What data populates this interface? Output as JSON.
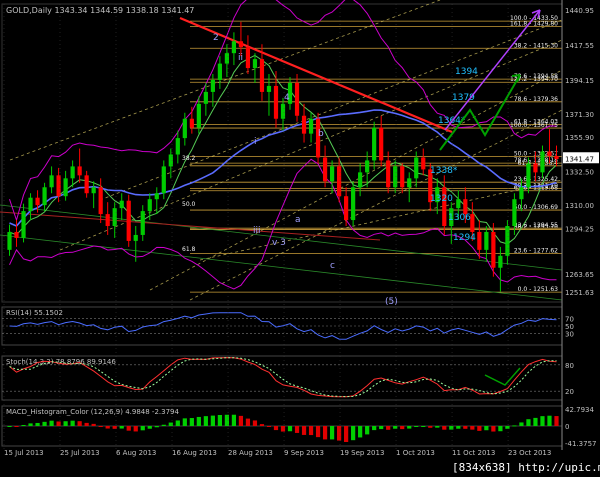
{
  "colors": {
    "background": "#000000",
    "bull": "#00cc00",
    "bear": "#ff0000",
    "axis_text": "#c0c0c0",
    "grid": "#404040",
    "ma": "#5a6cff",
    "ma_fast": "#55cc55",
    "bb": "#cc00cc",
    "fib": "#e0b040",
    "fib_text": "#f0f0f0",
    "trend_red": "#ff2020",
    "trend_green": "#00aa00",
    "trend_dotted": "#d0c060",
    "wave_label": "#a0a0ff",
    "target_label": "#20c0ff",
    "rsi": "#4a6cff",
    "stoch_main": "#ff3030",
    "stoch_signal": "#a0ffa0",
    "macd_pos": "#00d000",
    "macd_neg": "#e00000",
    "current_price_bg": "#ffffff",
    "arrow_green": "#00a000",
    "arrow_purple": "#b040ff"
  },
  "main_panel": {
    "header": "GOLD,Daily  1343.34 1344.59 1338.18 1341.47",
    "current_price": "1341.47",
    "price_axis_labels": [
      "1440.95",
      "1417.55",
      "1394.15",
      "1371.30",
      "1355.90",
      "1332.50",
      "1310.00",
      "1294.25",
      "1263.65",
      "1251.63"
    ],
    "ylim": [
      1245,
      1445
    ]
  },
  "date_labels": [
    "15 Jul 2013",
    "25 Jul 2013",
    "6 Aug 2013",
    "16 Aug 2013",
    "28 Aug 2013",
    "9 Sep 2013",
    "19 Sep 2013",
    "1 Oct 2013",
    "11 Oct 2013",
    "23 Oct 2013"
  ],
  "fib_labels_right": [
    {
      "text": "100.0 - 1433.50",
      "price": 1433.5
    },
    {
      "text": "161.8 - 1429.80",
      "price": 1429.8
    },
    {
      "text": "38.2 - 1415.30",
      "price": 1415.3
    },
    {
      "text": "78.6 - 1394.58",
      "price": 1394.58
    },
    {
      "text": "127.2 - 1394.70",
      "price": 1392.5
    },
    {
      "text": "78.6 - 1379.36",
      "price": 1379.36
    },
    {
      "text": "61.8 - 1364.03",
      "price": 1364.03
    },
    {
      "text": "100.0 - 1361.75",
      "price": 1361.75
    },
    {
      "text": "50.0 - 1342.57",
      "price": 1342.57
    },
    {
      "text": "78.6 - 1338.18",
      "price": 1338.18
    },
    {
      "text": "61.8 - 1336.4",
      "price": 1336.4
    },
    {
      "text": "23.6 - 1325.42",
      "price": 1325.42
    },
    {
      "text": "38.2 - 1321.10",
      "price": 1321.1
    },
    {
      "text": "61.8 - 1319.68",
      "price": 1319.68
    },
    {
      "text": "50.0 - 1306.69",
      "price": 1306.69
    },
    {
      "text": "38.2 - 1293.70",
      "price": 1293.7
    },
    {
      "text": "23.6 - 1294.55",
      "price": 1294.55
    },
    {
      "text": "23.6 - 1277.62",
      "price": 1277.62
    },
    {
      "text": "0.0 - 1251.63",
      "price": 1251.63
    }
  ],
  "wave_labels": [
    "2",
    "ii",
    "4",
    "b",
    "i",
    "iii",
    "v 3",
    "a",
    "c",
    "(5)",
    "38.2",
    "50.0",
    "61.8"
  ],
  "target_labels": [
    "1394",
    "1379",
    "1364*",
    "1338*",
    "1320",
    "1306",
    "1294"
  ],
  "chart_data": {
    "type": "candlestick",
    "title": "GOLD,Daily",
    "ohlc_header": {
      "open": 1343.34,
      "high": 1344.59,
      "low": 1338.18,
      "close": 1341.47
    },
    "x_tick_labels": [
      "15 Jul 2013",
      "25 Jul 2013",
      "6 Aug 2013",
      "16 Aug 2013",
      "28 Aug 2013",
      "9 Sep 2013",
      "19 Sep 2013",
      "1 Oct 2013",
      "11 Oct 2013",
      "23 Oct 2013"
    ],
    "y_tick_labels": [
      1440.95,
      1417.55,
      1394.15,
      1371.3,
      1355.9,
      1332.5,
      1310.0,
      1294.25,
      1263.65,
      1251.63
    ],
    "ylim": [
      1245,
      1445
    ],
    "candles": [
      [
        1280,
        1297,
        1276,
        1292
      ],
      [
        1292,
        1300,
        1282,
        1288
      ],
      [
        1288,
        1311,
        1285,
        1306
      ],
      [
        1306,
        1318,
        1300,
        1315
      ],
      [
        1315,
        1320,
        1305,
        1310
      ],
      [
        1310,
        1325,
        1306,
        1322
      ],
      [
        1322,
        1336,
        1318,
        1330
      ],
      [
        1330,
        1335,
        1312,
        1316
      ],
      [
        1316,
        1333,
        1313,
        1328
      ],
      [
        1328,
        1340,
        1322,
        1336
      ],
      [
        1336,
        1348,
        1325,
        1330
      ],
      [
        1330,
        1333,
        1315,
        1318
      ],
      [
        1318,
        1326,
        1308,
        1322
      ],
      [
        1322,
        1328,
        1298,
        1304
      ],
      [
        1304,
        1312,
        1290,
        1296
      ],
      [
        1296,
        1312,
        1288,
        1308
      ],
      [
        1308,
        1318,
        1300,
        1313
      ],
      [
        1313,
        1317,
        1282,
        1286
      ],
      [
        1286,
        1296,
        1272,
        1290
      ],
      [
        1290,
        1310,
        1286,
        1306
      ],
      [
        1306,
        1318,
        1300,
        1314
      ],
      [
        1314,
        1322,
        1304,
        1318
      ],
      [
        1318,
        1340,
        1314,
        1336
      ],
      [
        1336,
        1348,
        1328,
        1344
      ],
      [
        1344,
        1360,
        1338,
        1355
      ],
      [
        1355,
        1372,
        1350,
        1368
      ],
      [
        1368,
        1376,
        1358,
        1362
      ],
      [
        1362,
        1383,
        1358,
        1378
      ],
      [
        1378,
        1392,
        1370,
        1386
      ],
      [
        1386,
        1398,
        1376,
        1394
      ],
      [
        1394,
        1410,
        1388,
        1405
      ],
      [
        1405,
        1418,
        1396,
        1412
      ],
      [
        1412,
        1426,
        1404,
        1420
      ],
      [
        1420,
        1433,
        1410,
        1416
      ],
      [
        1416,
        1424,
        1398,
        1402
      ],
      [
        1402,
        1412,
        1392,
        1408
      ],
      [
        1408,
        1418,
        1380,
        1386
      ],
      [
        1386,
        1398,
        1370,
        1390
      ],
      [
        1390,
        1400,
        1362,
        1368
      ],
      [
        1368,
        1382,
        1360,
        1378
      ],
      [
        1378,
        1396,
        1374,
        1392
      ],
      [
        1392,
        1398,
        1366,
        1370
      ],
      [
        1370,
        1378,
        1352,
        1358
      ],
      [
        1358,
        1372,
        1352,
        1368
      ],
      [
        1368,
        1372,
        1338,
        1342
      ],
      [
        1342,
        1350,
        1322,
        1326
      ],
      [
        1326,
        1340,
        1318,
        1336
      ],
      [
        1336,
        1342,
        1312,
        1316
      ],
      [
        1316,
        1322,
        1296,
        1300
      ],
      [
        1300,
        1326,
        1296,
        1322
      ],
      [
        1322,
        1338,
        1316,
        1332
      ],
      [
        1332,
        1346,
        1322,
        1340
      ],
      [
        1340,
        1366,
        1334,
        1362
      ],
      [
        1362,
        1370,
        1336,
        1340
      ],
      [
        1340,
        1346,
        1318,
        1322
      ],
      [
        1322,
        1340,
        1318,
        1336
      ],
      [
        1336,
        1338,
        1318,
        1322
      ],
      [
        1322,
        1332,
        1312,
        1328
      ],
      [
        1328,
        1346,
        1322,
        1342
      ],
      [
        1342,
        1348,
        1330,
        1334
      ],
      [
        1334,
        1338,
        1306,
        1312
      ],
      [
        1312,
        1328,
        1304,
        1322
      ],
      [
        1322,
        1330,
        1290,
        1296
      ],
      [
        1296,
        1312,
        1284,
        1308
      ],
      [
        1308,
        1320,
        1300,
        1314
      ],
      [
        1314,
        1322,
        1298,
        1304
      ],
      [
        1304,
        1312,
        1286,
        1292
      ],
      [
        1292,
        1300,
        1274,
        1280
      ],
      [
        1280,
        1296,
        1272,
        1292
      ],
      [
        1292,
        1298,
        1262,
        1268
      ],
      [
        1268,
        1282,
        1252,
        1276
      ],
      [
        1276,
        1300,
        1270,
        1296
      ],
      [
        1296,
        1318,
        1290,
        1314
      ],
      [
        1314,
        1328,
        1306,
        1322
      ],
      [
        1322,
        1342,
        1318,
        1338
      ],
      [
        1338,
        1346,
        1326,
        1332
      ],
      [
        1332,
        1350,
        1328,
        1346
      ],
      [
        1346,
        1361,
        1338,
        1343
      ],
      [
        1343,
        1350,
        1336,
        1341
      ]
    ],
    "indicators": [
      {
        "name": "RSI(14)",
        "label": "RSI(14) 55.1502",
        "value": 55.1502,
        "levels": [
          70,
          50,
          30
        ]
      },
      {
        "name": "Stoch(14,3,3)",
        "label": "Stoch(14,3,3) 78.8796 89.9146",
        "values": [
          78.8796,
          89.9146
        ],
        "levels": [
          80,
          20
        ]
      },
      {
        "name": "MACD_Histogram_Color(12,26,9)",
        "label": "MACD_Histogram_Color (12,26,9) 4.9848 -2.3794",
        "values": [
          4.9848,
          -2.3794
        ],
        "levels": [
          0
        ]
      }
    ],
    "legend": "none"
  },
  "rsi_panel": {
    "label": "RSI(14) 55.1502",
    "axis_labels": [
      "70",
      "50",
      "30"
    ]
  },
  "stoch_panel": {
    "label": "Stoch(14,3,3) 78.8796 89.9146",
    "axis_labels": [
      "80",
      "20"
    ]
  },
  "macd_panel": {
    "label": "MACD_Histogram_Color (12,26,9) 4.9848 -2.3794",
    "axis_labels": [
      "42.7934",
      "0",
      "-41.3757"
    ]
  },
  "watermark": "[834x638] http://upic.me/"
}
